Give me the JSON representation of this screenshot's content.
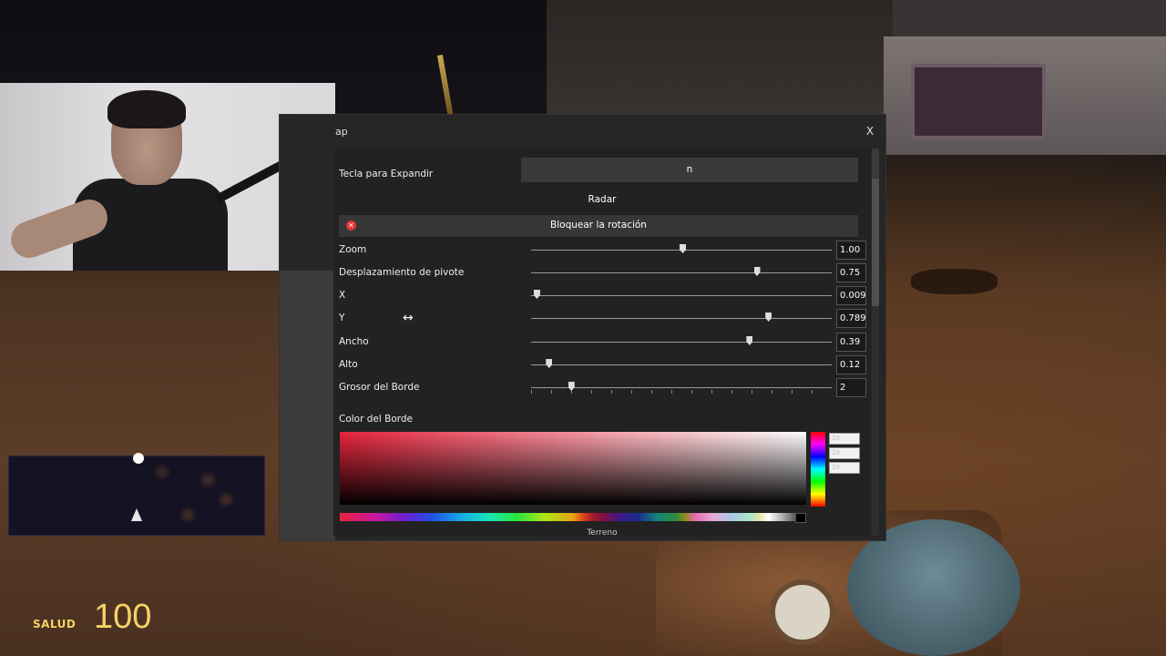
{
  "hud": {
    "health_label": "SALUD",
    "health_value": "100"
  },
  "dialog": {
    "title": "ap",
    "close_label": "X",
    "expand_key": {
      "label": "Tecla para Expandir",
      "value": "n"
    },
    "section_radar": "Radar",
    "lock_rotation": {
      "label": "Bloquear la rotación",
      "enabled": false,
      "icon": "close-circle-icon"
    },
    "sliders": [
      {
        "label": "Zoom",
        "value": "1.00",
        "fraction": 0.5
      },
      {
        "label": "Desplazamiento de pivote",
        "value": "0.75",
        "fraction": 0.75
      },
      {
        "label": "X",
        "value": "0.009",
        "fraction": 0.009
      },
      {
        "label": "Y",
        "value": "0.789",
        "fraction": 0.789
      },
      {
        "label": "Ancho",
        "value": "0.39",
        "fraction": 0.725
      },
      {
        "label": "Alto",
        "value": "0.12",
        "fraction": 0.05
      },
      {
        "label": "Grosor del Borde",
        "value": "2",
        "fraction": 0.125
      }
    ],
    "border_color_label": "Color del Borde",
    "rgb_fields": [
      "20",
      "20",
      "20"
    ],
    "next_section": "Terreno"
  },
  "colors": {
    "dialog_bg": "#262626",
    "accent_red": "#e8243c",
    "hud_yellow": "#f4d266"
  }
}
